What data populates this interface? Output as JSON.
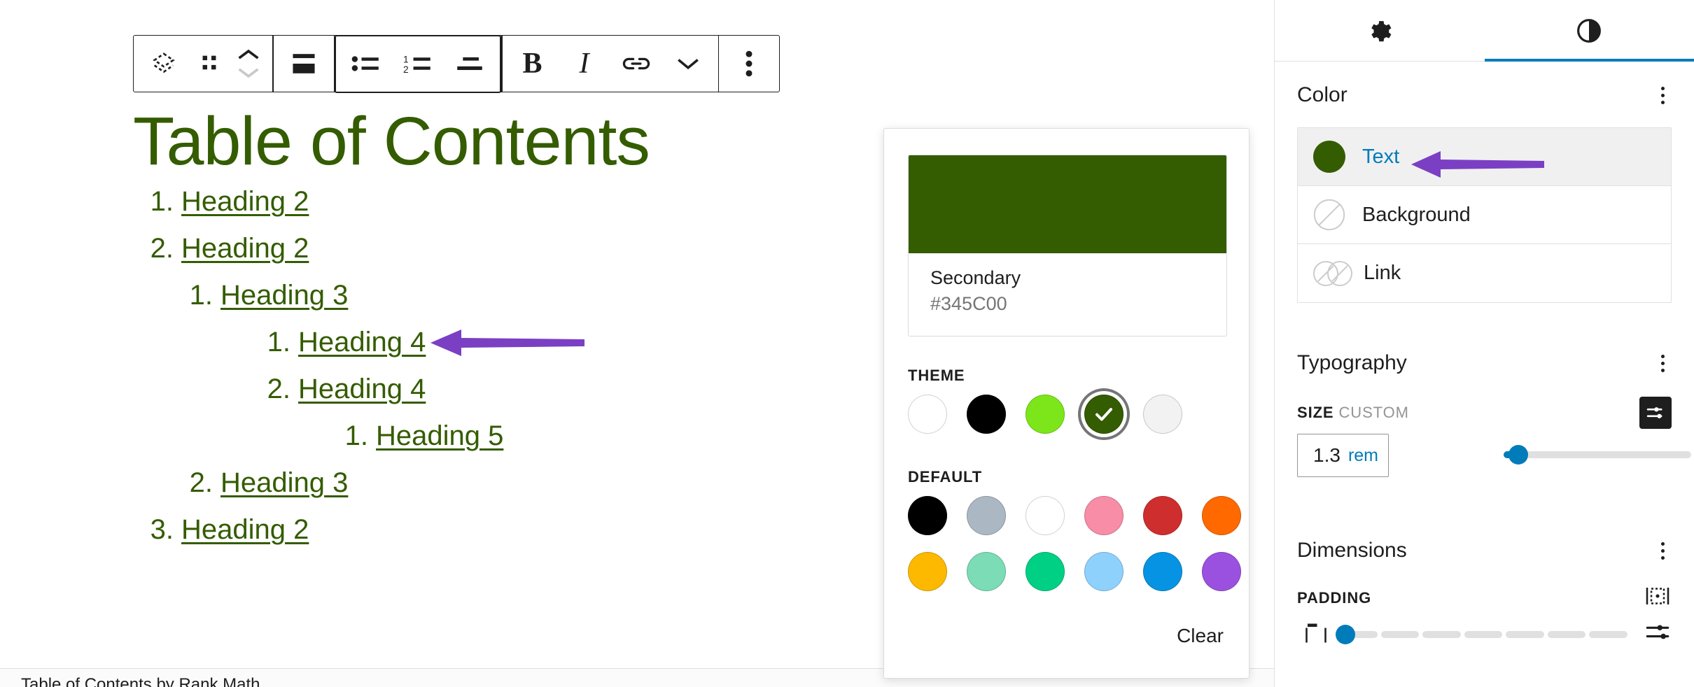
{
  "toolbar": {
    "buttons": [
      {
        "name": "block-type-list-icon",
        "label": "Change block type"
      },
      {
        "name": "drag-handle-icon",
        "label": "Drag"
      },
      {
        "name": "move-up-down-icon",
        "label": "Move up or down"
      },
      {
        "name": "align-icon",
        "label": "Align"
      },
      {
        "name": "unordered-list-icon",
        "label": "Bullet list"
      },
      {
        "name": "ordered-list-icon",
        "label": "Numbered list"
      },
      {
        "name": "indent-icon",
        "label": "Indent"
      },
      {
        "name": "bold-icon",
        "label": "Bold"
      },
      {
        "name": "italic-icon",
        "label": "Italic"
      },
      {
        "name": "link-icon",
        "label": "Link"
      },
      {
        "name": "chevron-down-icon",
        "label": "More rich text controls"
      },
      {
        "name": "options-kebab-icon",
        "label": "Options"
      }
    ],
    "bold_glyph": "B",
    "italic_glyph": "I"
  },
  "document": {
    "title": "Table of Contents",
    "footer": "Table of Contents by Rank Math",
    "toc": [
      {
        "marker": "1.",
        "text": "Heading 2",
        "depth": 0
      },
      {
        "marker": "2.",
        "text": "Heading 2",
        "depth": 0
      },
      {
        "marker": "1.",
        "text": "Heading 3",
        "depth": 1
      },
      {
        "marker": "1.",
        "text": "Heading 4",
        "depth": 2
      },
      {
        "marker": "2.",
        "text": "Heading 4",
        "depth": 2
      },
      {
        "marker": "1.",
        "text": "Heading 5",
        "depth": 3
      },
      {
        "marker": "2.",
        "text": "Heading 3",
        "depth": 1
      },
      {
        "marker": "3.",
        "text": "Heading 2",
        "depth": 0
      }
    ],
    "text_color": "#345C00"
  },
  "color_popover": {
    "swatch_card": {
      "name": "Secondary",
      "hex": "#345C00",
      "color": "#345C00"
    },
    "theme_label": "THEME",
    "theme_swatches": [
      {
        "name": "white",
        "color": "#ffffff",
        "selected": false
      },
      {
        "name": "black",
        "color": "#000000",
        "selected": false
      },
      {
        "name": "bright-green",
        "color": "#7CE61A",
        "selected": false
      },
      {
        "name": "secondary-dark-green",
        "color": "#345C00",
        "selected": true
      },
      {
        "name": "light-gray",
        "color": "#f2f2f2",
        "selected": false
      }
    ],
    "default_label": "DEFAULT",
    "default_swatches": [
      {
        "name": "black",
        "color": "#000000"
      },
      {
        "name": "cyan-bluish-gray",
        "color": "#abb8c3"
      },
      {
        "name": "white",
        "color": "#ffffff"
      },
      {
        "name": "pale-pink",
        "color": "#f78da7"
      },
      {
        "name": "vivid-red",
        "color": "#cf2e2e"
      },
      {
        "name": "luminous-vivid-orange",
        "color": "#ff6900"
      },
      {
        "name": "luminous-vivid-amber",
        "color": "#fcb900"
      },
      {
        "name": "light-green-cyan",
        "color": "#7bdcb5"
      },
      {
        "name": "vivid-green-cyan",
        "color": "#00d084"
      },
      {
        "name": "pale-cyan-blue",
        "color": "#8ed1fc"
      },
      {
        "name": "vivid-cyan-blue",
        "color": "#0693e3"
      },
      {
        "name": "vivid-purple",
        "color": "#9b51e0"
      }
    ],
    "clear_label": "Clear"
  },
  "sidebar": {
    "tabs": [
      {
        "name": "settings-tab",
        "icon": "gear-icon",
        "active": false
      },
      {
        "name": "styles-tab",
        "icon": "contrast-icon",
        "active": true
      }
    ],
    "color": {
      "title": "Color",
      "rows": [
        {
          "name": "text",
          "label": "Text",
          "swatch": "#345C00",
          "selected": true,
          "empty": false
        },
        {
          "name": "background",
          "label": "Background",
          "swatch": "",
          "selected": false,
          "empty": true
        },
        {
          "name": "link",
          "label": "Link",
          "swatch": "",
          "selected": false,
          "empty": true,
          "double": true
        }
      ]
    },
    "typography": {
      "title": "Typography",
      "size_label": "SIZE",
      "size_preset": "CUSTOM",
      "size_value": "1.3",
      "size_unit": "rem",
      "slider_percent": 8
    },
    "dimensions": {
      "title": "Dimensions",
      "padding_label": "PADDING",
      "padding_percent": 0
    }
  },
  "accent": {
    "blue": "#007cba",
    "arrow_purple": "#7b3fc4",
    "border": "#e0e0e0"
  }
}
